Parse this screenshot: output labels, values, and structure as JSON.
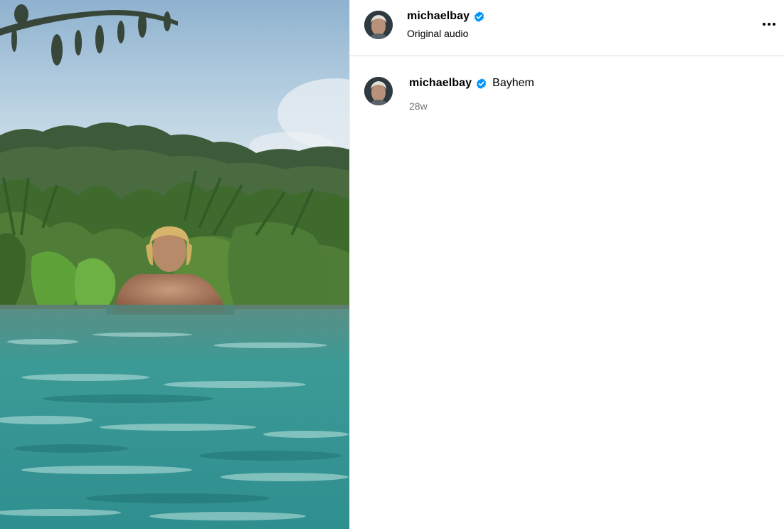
{
  "post": {
    "username": "michaelbay",
    "audio_label": "Original audio",
    "caption": {
      "username": "michaelbay",
      "text": "Bayhem",
      "time_ago": "28w"
    }
  },
  "icons": {
    "verified": "verified-badge-icon",
    "more": "more-options-icon"
  },
  "colors": {
    "verified_blue": "#0095f6",
    "secondary_text": "#737373",
    "divider": "#dbdbdb",
    "pool_water": "#3f9c9a",
    "foliage": "#3f6a2e"
  }
}
